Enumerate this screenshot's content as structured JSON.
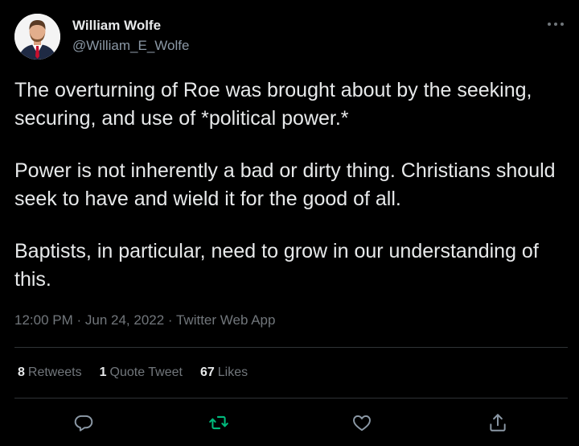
{
  "author": {
    "name": "William Wolfe",
    "handle": "@William_E_Wolfe"
  },
  "tweet": {
    "paragraphs": [
      "The overturning of Roe was brought about by the seeking, securing, and use of *political power.*",
      "Power is not inherently a bad or dirty thing. Christians should seek to have and wield it for the good of all.",
      "Baptists, in particular, need to grow in our understanding of this."
    ],
    "meta": "12:00 PM · Jun 24, 2022 · Twitter Web App"
  },
  "stats": {
    "retweets_count": "8",
    "retweets_label": "Retweets",
    "quotes_count": "1",
    "quotes_label": "Quote Tweet",
    "likes_count": "67",
    "likes_label": "Likes"
  },
  "actions": [
    {
      "icon": "reply-icon"
    },
    {
      "icon": "retweet-icon"
    },
    {
      "icon": "like-icon"
    },
    {
      "icon": "share-icon"
    }
  ],
  "colors": {
    "background": "#000000",
    "text": "#e7e9ea",
    "secondary": "#71767b",
    "retweet_icon": "#00ba7c",
    "divider": "#2f3336"
  }
}
